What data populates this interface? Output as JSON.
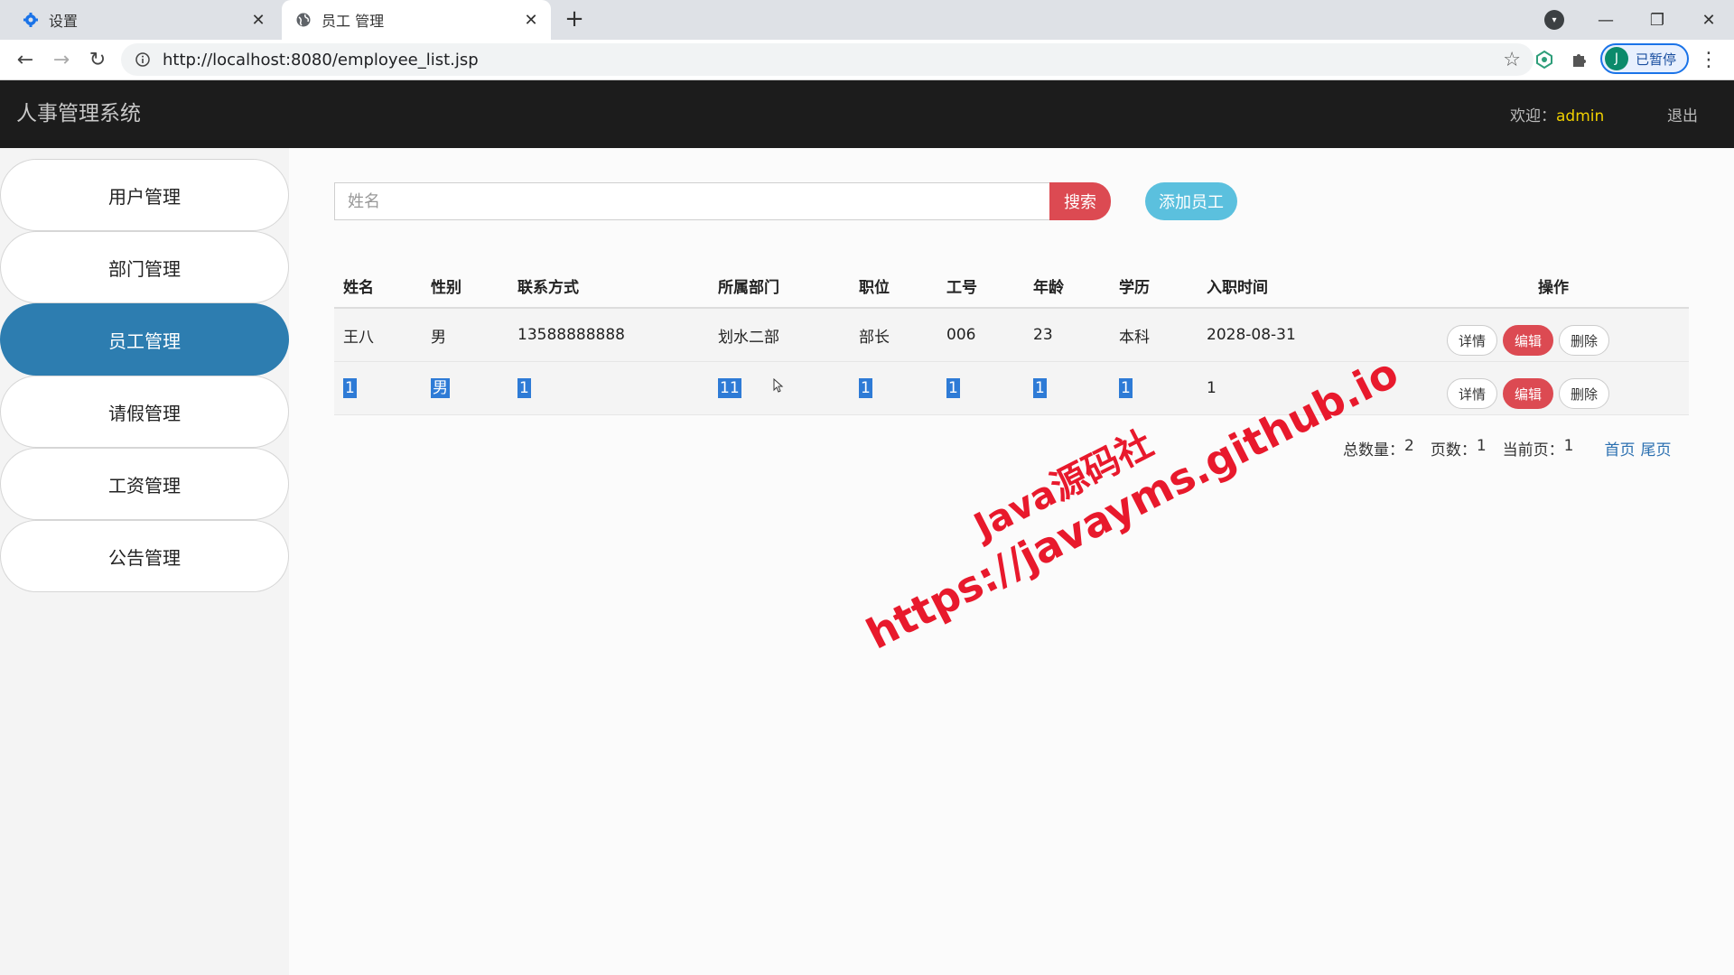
{
  "browser": {
    "tabs": [
      {
        "label": "设置",
        "icon": "gear-icon",
        "active": false
      },
      {
        "label": "员工 管理",
        "icon": "globe-icon",
        "active": true
      }
    ],
    "new_tab": "+",
    "url": "http://localhost:8080/employee_list.jsp",
    "profile_initial": "J",
    "profile_status": "已暂停",
    "accent": "#1a73e8"
  },
  "app": {
    "brand": "人事管理系统",
    "welcome_prefix": "欢迎：",
    "username": "admin",
    "logout": "退出",
    "colors": {
      "header": "#1c1c1c",
      "sidebar_active": "#2d7db0",
      "danger": "#dc4a52",
      "info": "#5bc0de",
      "username": "#f0d000"
    }
  },
  "sidebar": {
    "items": [
      {
        "label": "用户管理",
        "active": false
      },
      {
        "label": "部门管理",
        "active": false
      },
      {
        "label": "员工管理",
        "active": true
      },
      {
        "label": "请假管理",
        "active": false
      },
      {
        "label": "工资管理",
        "active": false
      },
      {
        "label": "公告管理",
        "active": false
      }
    ]
  },
  "search": {
    "placeholder": "姓名",
    "value": "",
    "search_label": "搜索",
    "add_label": "添加员工"
  },
  "table": {
    "columns": [
      "姓名",
      "性别",
      "联系方式",
      "所属部门",
      "职位",
      "工号",
      "年龄",
      "学历",
      "入职时间",
      "操作"
    ],
    "rows": [
      {
        "name": "王八",
        "gender": "男",
        "phone": "13588888888",
        "dept": "划水二部",
        "position": "部长",
        "empno": "006",
        "age": "23",
        "edu": "本科",
        "hired": "2028-08-31"
      },
      {
        "name": "1",
        "gender": "男",
        "phone": "1",
        "dept": "11",
        "position": "1",
        "empno": "1",
        "age": "1",
        "edu": "1",
        "hired": "1"
      }
    ],
    "actions": {
      "detail": "详情",
      "edit": "编辑",
      "delete": "删除"
    }
  },
  "pager": {
    "total_label": "总数量：",
    "total": "2",
    "pages_label": "页数：",
    "pages": "1",
    "current_label": "当前页：",
    "current": "1",
    "first": "首页",
    "last": "尾页"
  },
  "watermark": {
    "line1": "Java源码社",
    "line2": "https://javayms.github.io"
  }
}
